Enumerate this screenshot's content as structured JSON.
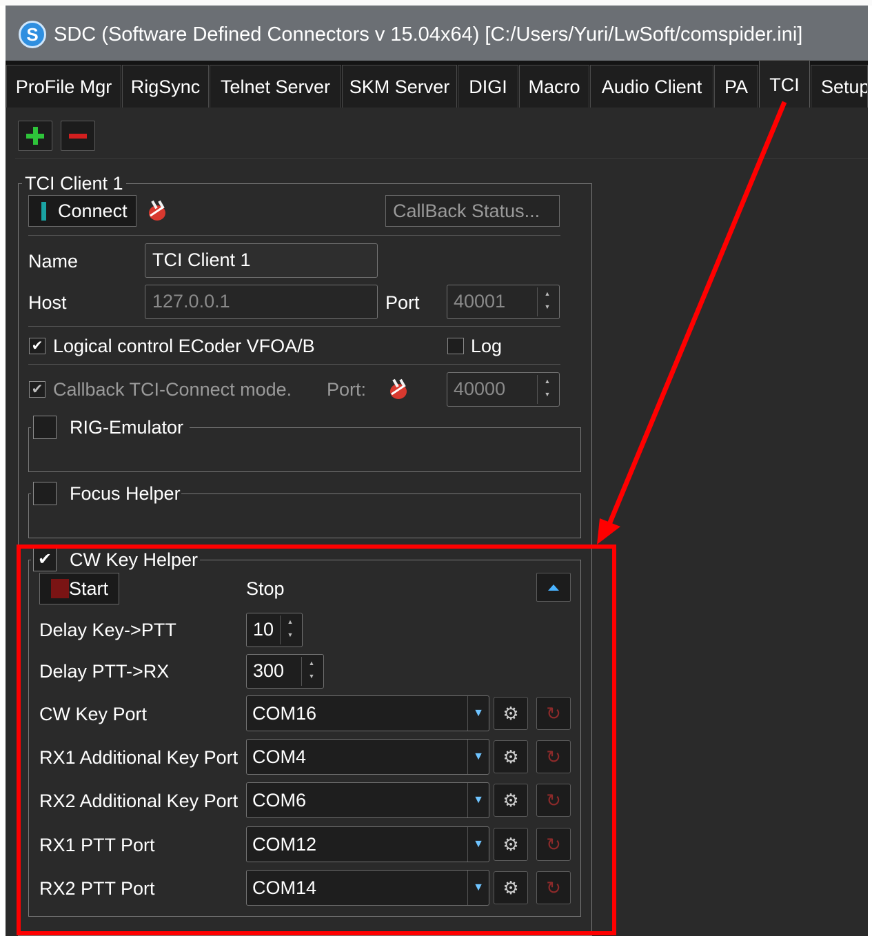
{
  "window": {
    "title": "SDC (Software Defined Connectors v 15.04x64) [C:/Users/Yuri/LwSoft/comspider.ini]",
    "logo_letter": "S"
  },
  "tabs": [
    {
      "label": "ProFile Mgr"
    },
    {
      "label": "RigSync"
    },
    {
      "label": "Telnet Server"
    },
    {
      "label": "SKM Server"
    },
    {
      "label": "DIGI"
    },
    {
      "label": "Macro"
    },
    {
      "label": "Audio Client"
    },
    {
      "label": "PA"
    },
    {
      "label": "TCI",
      "active": true
    },
    {
      "label": "Setup"
    }
  ],
  "toolbar": {
    "add_symbol": "+",
    "remove_symbol": "−"
  },
  "tci_client": {
    "group_title": "TCI Client 1",
    "connect_label": "Connect",
    "callback_status_label": "CallBack Status...",
    "name_label": "Name",
    "name_value": "TCI Client 1",
    "host_label": "Host",
    "host_value": "127.0.0.1",
    "port_label": "Port",
    "port_value": "40001",
    "logical_control_label": "Logical control ECoder VFOA/B",
    "logical_control_checked": true,
    "log_label": "Log",
    "log_checked": false,
    "callback_mode_label": "Callback TCI-Connect mode.",
    "callback_mode_checked": true,
    "callback_port_label": "Port:",
    "callback_port_value": "40000"
  },
  "rig_emulator": {
    "label": "RIG-Emulator",
    "checked": false
  },
  "focus_helper": {
    "label": "Focus Helper",
    "checked": false
  },
  "cw_key_helper": {
    "label": "CW Key Helper",
    "checked": true,
    "start_label": "Start",
    "stop_label": "Stop",
    "delay_key_ptt_label": "Delay Key->PTT",
    "delay_key_ptt_value": "10",
    "delay_ptt_rx_label": "Delay PTT->RX",
    "delay_ptt_rx_value": "300",
    "ports": [
      {
        "label": "CW Key Port",
        "value": "COM16"
      },
      {
        "label": "RX1 Additional Key Port",
        "value": "COM4"
      },
      {
        "label": "RX2 Additional Key Port",
        "value": "COM6"
      },
      {
        "label": "RX1 PTT Port",
        "value": "COM12"
      },
      {
        "label": "RX2 PTT Port",
        "value": "COM14"
      }
    ]
  },
  "icons": {
    "plug": "plug-icon",
    "gear": "gear-icon",
    "refresh": "refresh-icon",
    "collapse": "collapse-up-icon",
    "dropdown": "dropdown-arrow-icon"
  },
  "colors": {
    "highlight": "#ff0000",
    "background": "#2a2a2a",
    "titlebar": "#6b6f74",
    "accent_teal": "#1aa3a3",
    "start_red": "#7a1414"
  }
}
